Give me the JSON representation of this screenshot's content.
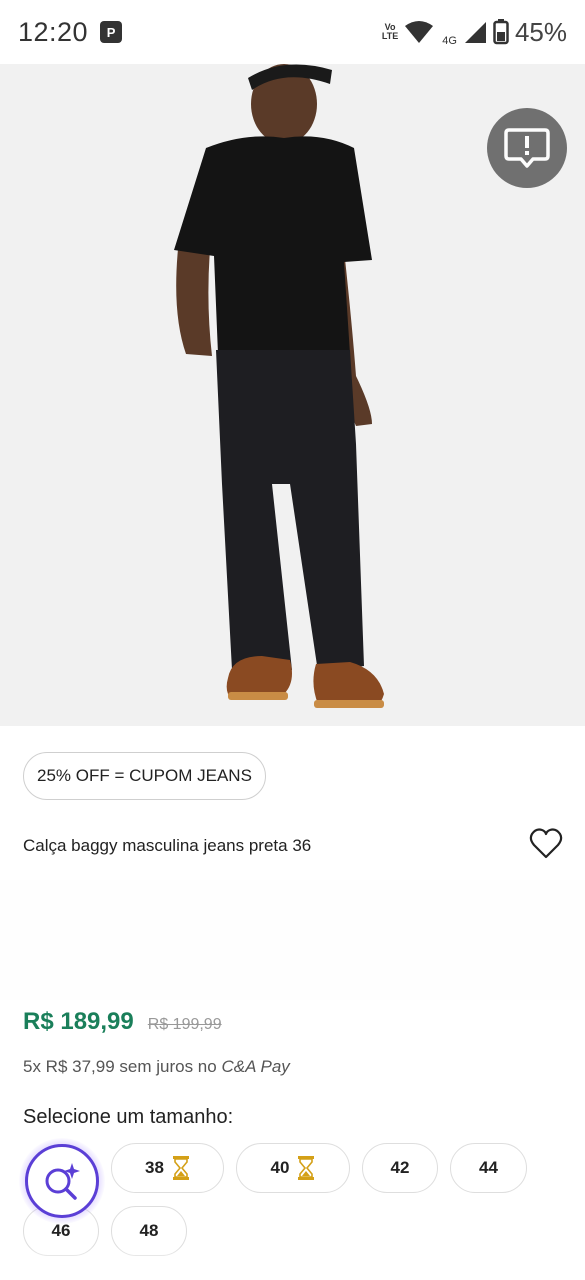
{
  "status_bar": {
    "time": "12:20",
    "notification": "P",
    "volte_top": "Vo",
    "volte_bottom": "LTE",
    "network": "4G",
    "battery": "45%"
  },
  "product": {
    "coupon": "25% OFF = CUPOM JEANS",
    "title": "Calça baggy masculina jeans preta 36",
    "price_current": "R$ 189,99",
    "price_old": "R$ 199,99",
    "installments_text": "5x R$ 37,99 sem juros no ",
    "installments_brand": "C&A Pay"
  },
  "sizes": {
    "heading": "Selecione um tamanho:",
    "options": [
      {
        "label": "38",
        "status_icon": "hourglass-icon"
      },
      {
        "label": "40",
        "status_icon": "hourglass-icon"
      },
      {
        "label": "42"
      },
      {
        "label": "44"
      },
      {
        "label": "46"
      },
      {
        "label": "48"
      }
    ]
  },
  "colors": {
    "price_green": "#1a7f5a",
    "accent_purple": "#5b3fd6",
    "hourglass_gold": "#d4a017"
  }
}
